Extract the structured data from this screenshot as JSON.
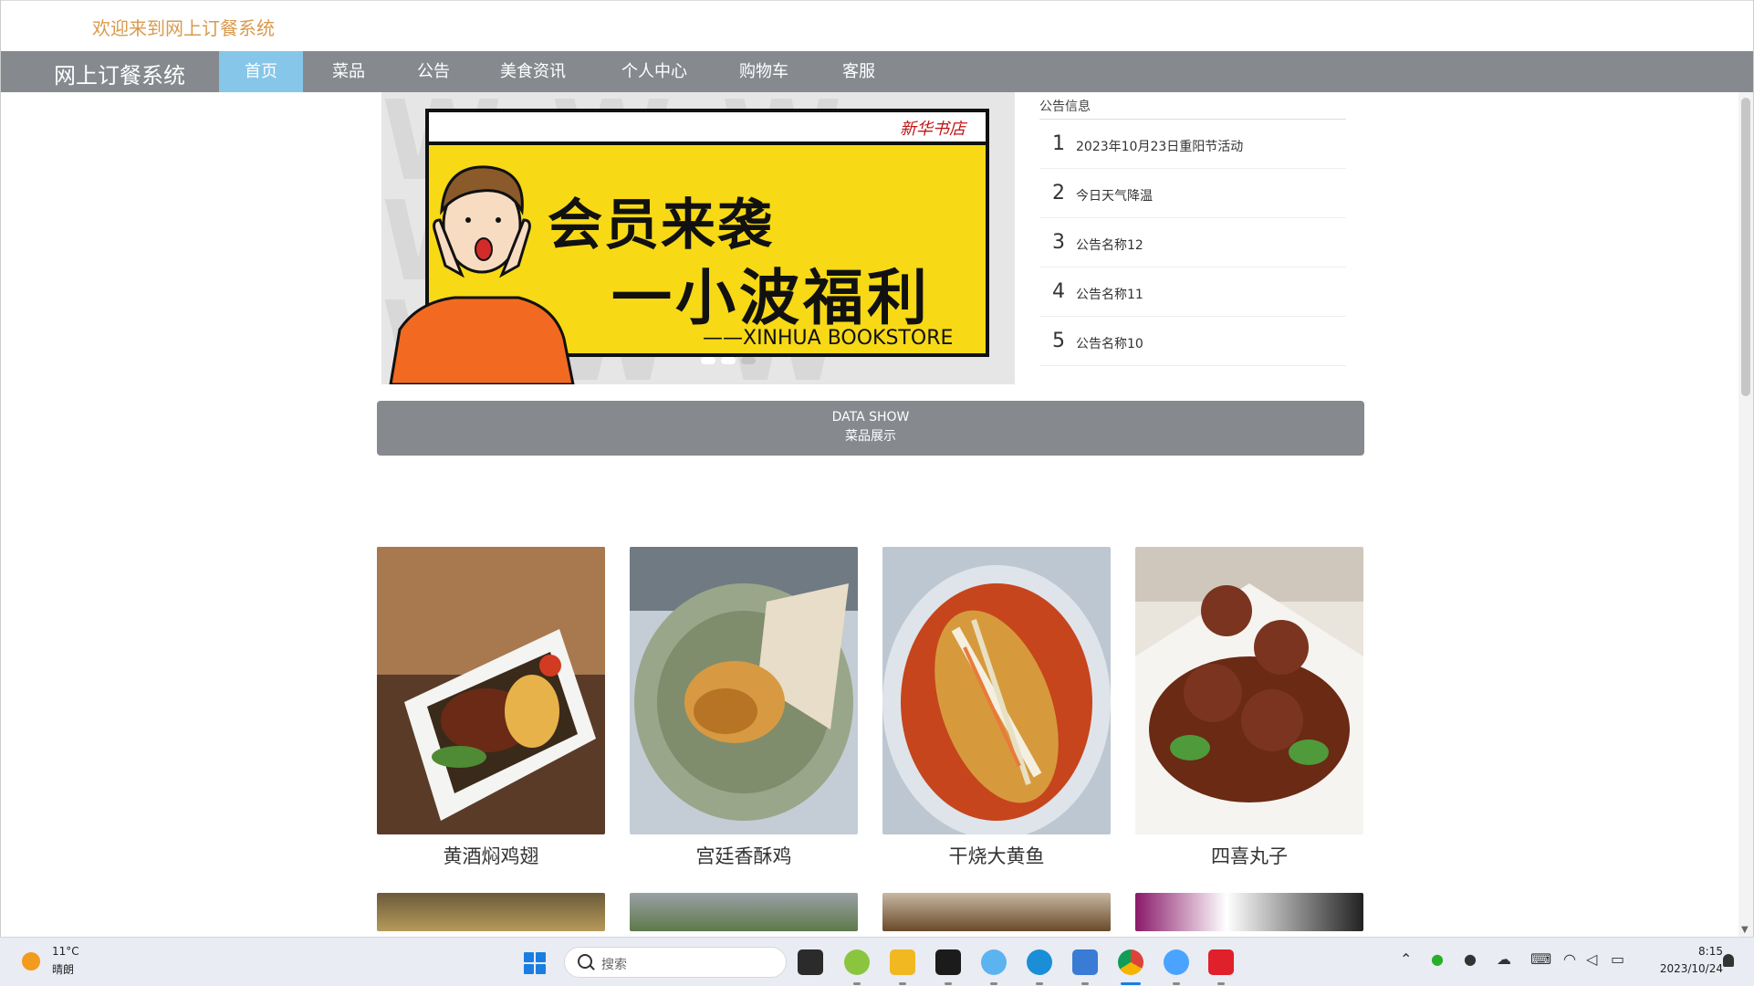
{
  "header": {
    "welcome": "欢迎来到网上订餐系统"
  },
  "nav": {
    "brand": "网上订餐系统",
    "items": [
      {
        "label": "首页",
        "active": true
      },
      {
        "label": "菜品",
        "active": false
      },
      {
        "label": "公告",
        "active": false
      },
      {
        "label": "美食资讯",
        "active": false
      },
      {
        "label": "个人中心",
        "active": false
      },
      {
        "label": "购物车",
        "active": false
      },
      {
        "label": "客服",
        "active": false
      }
    ]
  },
  "banner": {
    "logo_text": "新华书店",
    "headline_1": "会员来袭",
    "headline_2": "一小波福利",
    "signature": "——XINHUA BOOKSTORE",
    "slide_count": 3,
    "active_slide": 1
  },
  "notices": {
    "title": "公告信息",
    "items": [
      {
        "num": "1",
        "text": "2023年10月23日重阳节活动"
      },
      {
        "num": "2",
        "text": "今日天气降温"
      },
      {
        "num": "3",
        "text": "公告名称12"
      },
      {
        "num": "4",
        "text": "公告名称11"
      },
      {
        "num": "5",
        "text": "公告名称10"
      }
    ]
  },
  "data_show": {
    "title_en": "DATA SHOW",
    "title_cn": "菜品展示"
  },
  "dishes": [
    {
      "name": "黄酒焖鸡翅"
    },
    {
      "name": "宫廷香酥鸡"
    },
    {
      "name": "干烧大黄鱼"
    },
    {
      "name": "四喜丸子"
    }
  ],
  "taskbar": {
    "weather_temp": "11°C",
    "weather_desc": "晴朗",
    "search_placeholder": "搜索",
    "time": "8:15",
    "date": "2023/10/24"
  },
  "colors": {
    "nav_bg": "#868a8f",
    "nav_active": "#86c6e9",
    "welcome_text": "#d99a4e",
    "poster_yellow": "#f7d916"
  }
}
